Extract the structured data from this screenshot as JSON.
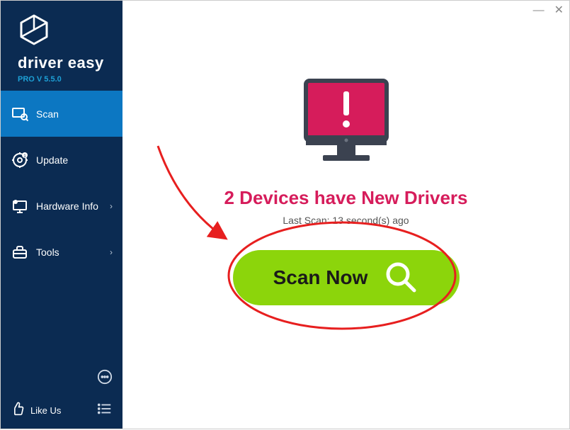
{
  "brand": {
    "name": "driver easy",
    "version": "PRO V 5.5.0"
  },
  "sidebar": {
    "items": [
      {
        "label": "Scan",
        "active": true,
        "expandable": false
      },
      {
        "label": "Update",
        "active": false,
        "expandable": false
      },
      {
        "label": "Hardware Info",
        "active": false,
        "expandable": true
      },
      {
        "label": "Tools",
        "active": false,
        "expandable": true
      }
    ],
    "like": "Like Us"
  },
  "main": {
    "headline": "2 Devices have New Drivers",
    "last_scan": "Last Scan: 13 second(s) ago",
    "scan_button": "Scan Now"
  },
  "colors": {
    "sidebar_bg": "#0b2b52",
    "sidebar_active": "#0c77c2",
    "accent_cyan": "#1da0d6",
    "headline": "#d61c5b",
    "scan_btn": "#8cd50b",
    "annotation": "#e71f1f"
  }
}
